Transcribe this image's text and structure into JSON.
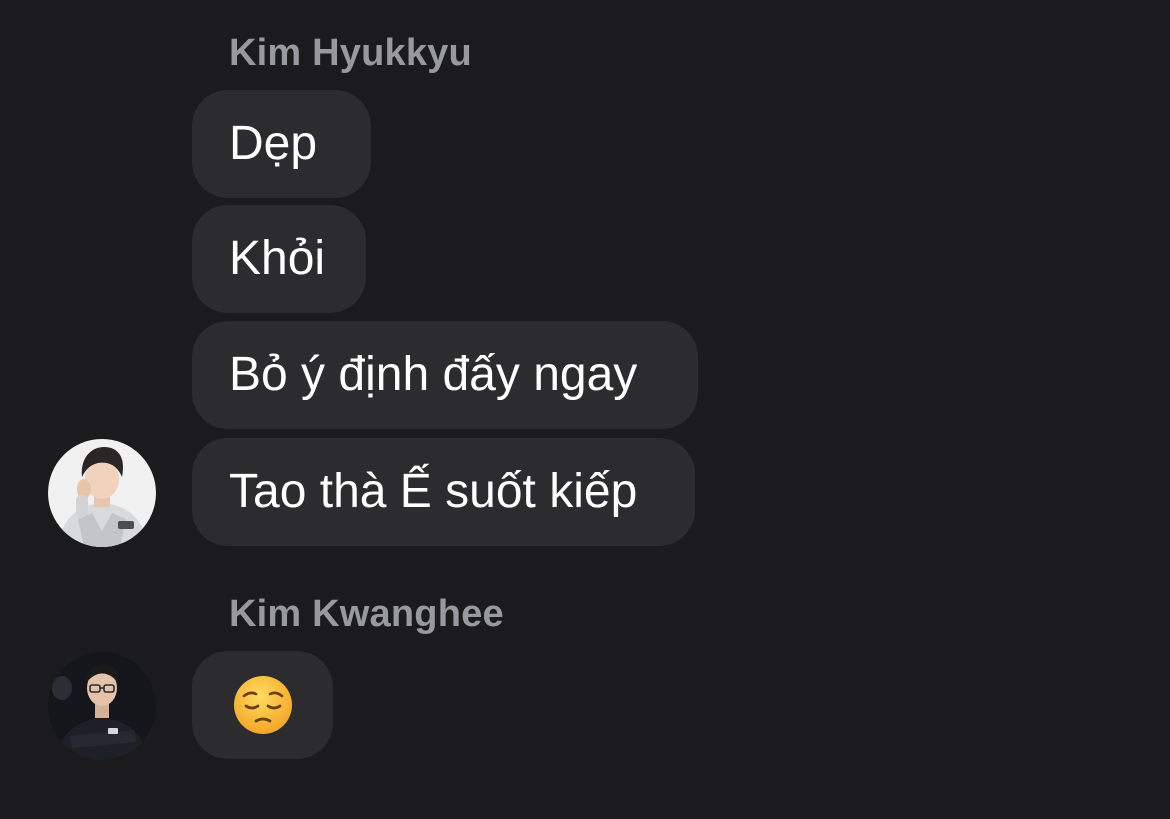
{
  "groups": [
    {
      "sender": "Kim Hyukkyu",
      "messages": [
        "Dẹp",
        "Khỏi",
        "Bỏ ý định đấy ngay",
        "Tao thà Ế suốt kiếp"
      ]
    },
    {
      "sender": "Kim Kwanghee",
      "messages": [
        "😔"
      ]
    }
  ],
  "colors": {
    "background": "#1b1b1d",
    "bubble": "#2c2c2e",
    "sender_name": "#98989f",
    "message_text": "#ffffff"
  },
  "icons": {
    "avatar_1": "profile-photo-light",
    "avatar_2": "profile-photo-dark"
  }
}
